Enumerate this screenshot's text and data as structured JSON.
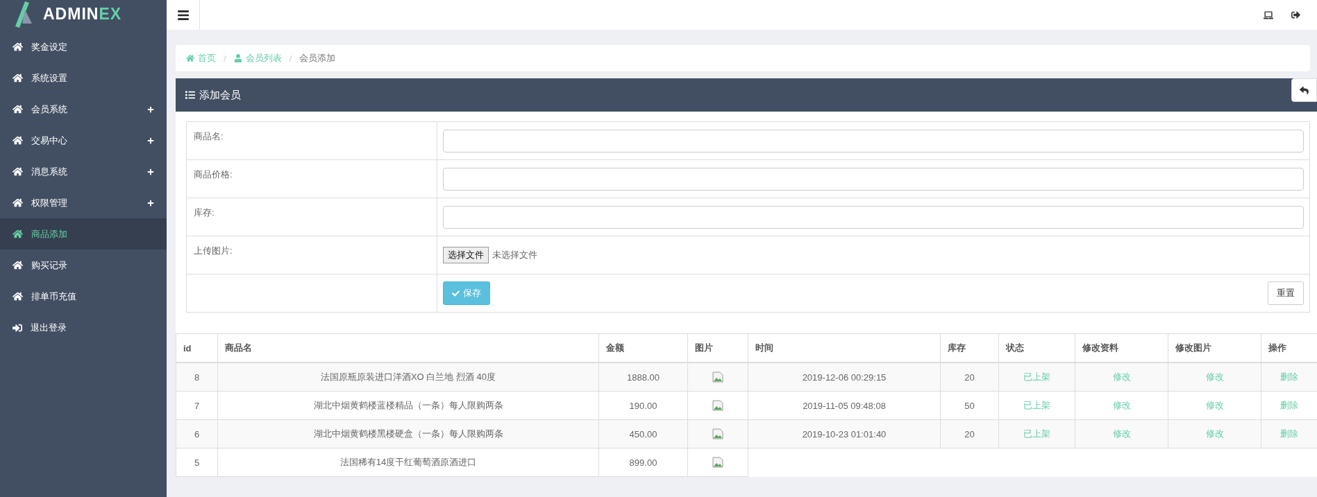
{
  "logo": {
    "text": "ADMIN",
    "accent": "EX"
  },
  "sidebar": {
    "items": [
      {
        "kind": "home",
        "label": "奖金设定",
        "expandable": false,
        "selected": false
      },
      {
        "kind": "home",
        "label": "系统设置",
        "expandable": false,
        "selected": false
      },
      {
        "kind": "home",
        "label": "会员系统",
        "expandable": true,
        "selected": false
      },
      {
        "kind": "home",
        "label": "交易中心",
        "expandable": true,
        "selected": false
      },
      {
        "kind": "home",
        "label": "消息系统",
        "expandable": true,
        "selected": false
      },
      {
        "kind": "home",
        "label": "权限管理",
        "expandable": true,
        "selected": false
      },
      {
        "kind": "home",
        "label": "商品添加",
        "expandable": false,
        "selected": true
      },
      {
        "kind": "home",
        "label": "购买记录",
        "expandable": false,
        "selected": false
      },
      {
        "kind": "home",
        "label": "排单币充值",
        "expandable": false,
        "selected": false
      },
      {
        "kind": "logout",
        "label": "退出登录",
        "expandable": false,
        "selected": false
      }
    ]
  },
  "breadcrumb": [
    {
      "kind": "home",
      "label": "首页",
      "link": true
    },
    {
      "kind": "user",
      "separator": "/",
      "label": "会员列表",
      "link": true
    },
    {
      "kind": "none",
      "separator": "/",
      "label": "会员添加",
      "link": false
    }
  ],
  "panel": {
    "title": "添加会员"
  },
  "form": {
    "fields": [
      {
        "kind": "text",
        "label": "商品名:"
      },
      {
        "kind": "text",
        "label": "商品价格:"
      },
      {
        "kind": "text",
        "label": "库存:"
      },
      {
        "kind": "file",
        "label": "上传图片:",
        "button": "选择文件",
        "status": "未选择文件"
      }
    ],
    "save": "保存",
    "reset": "重置"
  },
  "table": {
    "columns": [
      "id",
      "商品名",
      "金额",
      "图片",
      "时间",
      "库存",
      "状态",
      "修改资料",
      "修改图片",
      "操作"
    ],
    "rows": [
      {
        "id": "8",
        "name": "法国原瓶原装进口洋酒XO 白兰地 烈酒 40度",
        "amount": "1888.00",
        "time": "2019-12-06 00:29:15",
        "stock": "20",
        "status": "已上架",
        "edit_info": "修改",
        "edit_image": "修改",
        "action": "删除"
      },
      {
        "id": "7",
        "name": "湖北中烟黄鹤楼蓝楼精品（一条）每人限购两条",
        "amount": "190.00",
        "time": "2019-11-05 09:48:08",
        "stock": "50",
        "status": "已上架",
        "edit_info": "修改",
        "edit_image": "修改",
        "action": "删除"
      },
      {
        "id": "6",
        "name": "湖北中烟黄鹤楼黑楼硬盒（一条）每人限购两条",
        "amount": "450.00",
        "time": "2019-10-23 01:01:40",
        "stock": "20",
        "status": "已上架",
        "edit_info": "修改",
        "edit_image": "修改",
        "action": "删除"
      },
      {
        "id": "5",
        "name": "法国稀有14度干红葡萄酒原酒进口",
        "amount": "899.00"
      }
    ]
  }
}
